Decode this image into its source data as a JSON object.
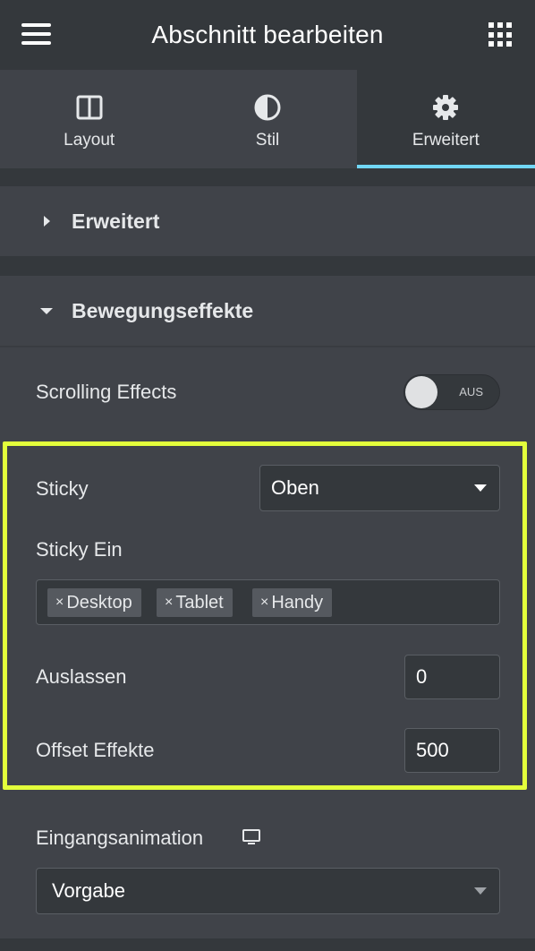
{
  "header": {
    "title": "Abschnitt bearbeiten",
    "menu_icon": "hamburger-icon",
    "apps_icon": "grid-icon"
  },
  "tabs": [
    {
      "label": "Layout",
      "icon": "layout-columns-icon",
      "active": false
    },
    {
      "label": "Stil",
      "icon": "half-circle-contrast-icon",
      "active": false
    },
    {
      "label": "Erweitert",
      "icon": "gear-icon",
      "active": true
    }
  ],
  "sections": {
    "advanced": {
      "label": "Erweitert",
      "expanded": false
    },
    "motion": {
      "label": "Bewegungseffekte",
      "expanded": true
    }
  },
  "scrolling": {
    "label": "Scrolling Effects",
    "toggle_state": "AUS"
  },
  "sticky": {
    "label": "Sticky",
    "value": "Oben",
    "on_label": "Sticky Ein",
    "devices": [
      "Desktop",
      "Tablet",
      "Handy"
    ],
    "remove_symbol": "×",
    "offset_label": "Auslassen",
    "offset_value": "0",
    "effects_offset_label": "Offset Effekte",
    "effects_offset_value": "500"
  },
  "entrance": {
    "label": "Eingangsanimation",
    "value": "Vorgabe",
    "device_icon": "monitor-icon"
  },
  "colors": {
    "accent": "#71d7f7",
    "highlight": "#e3ff3b",
    "panel": "#404349",
    "dark": "#34383c"
  }
}
